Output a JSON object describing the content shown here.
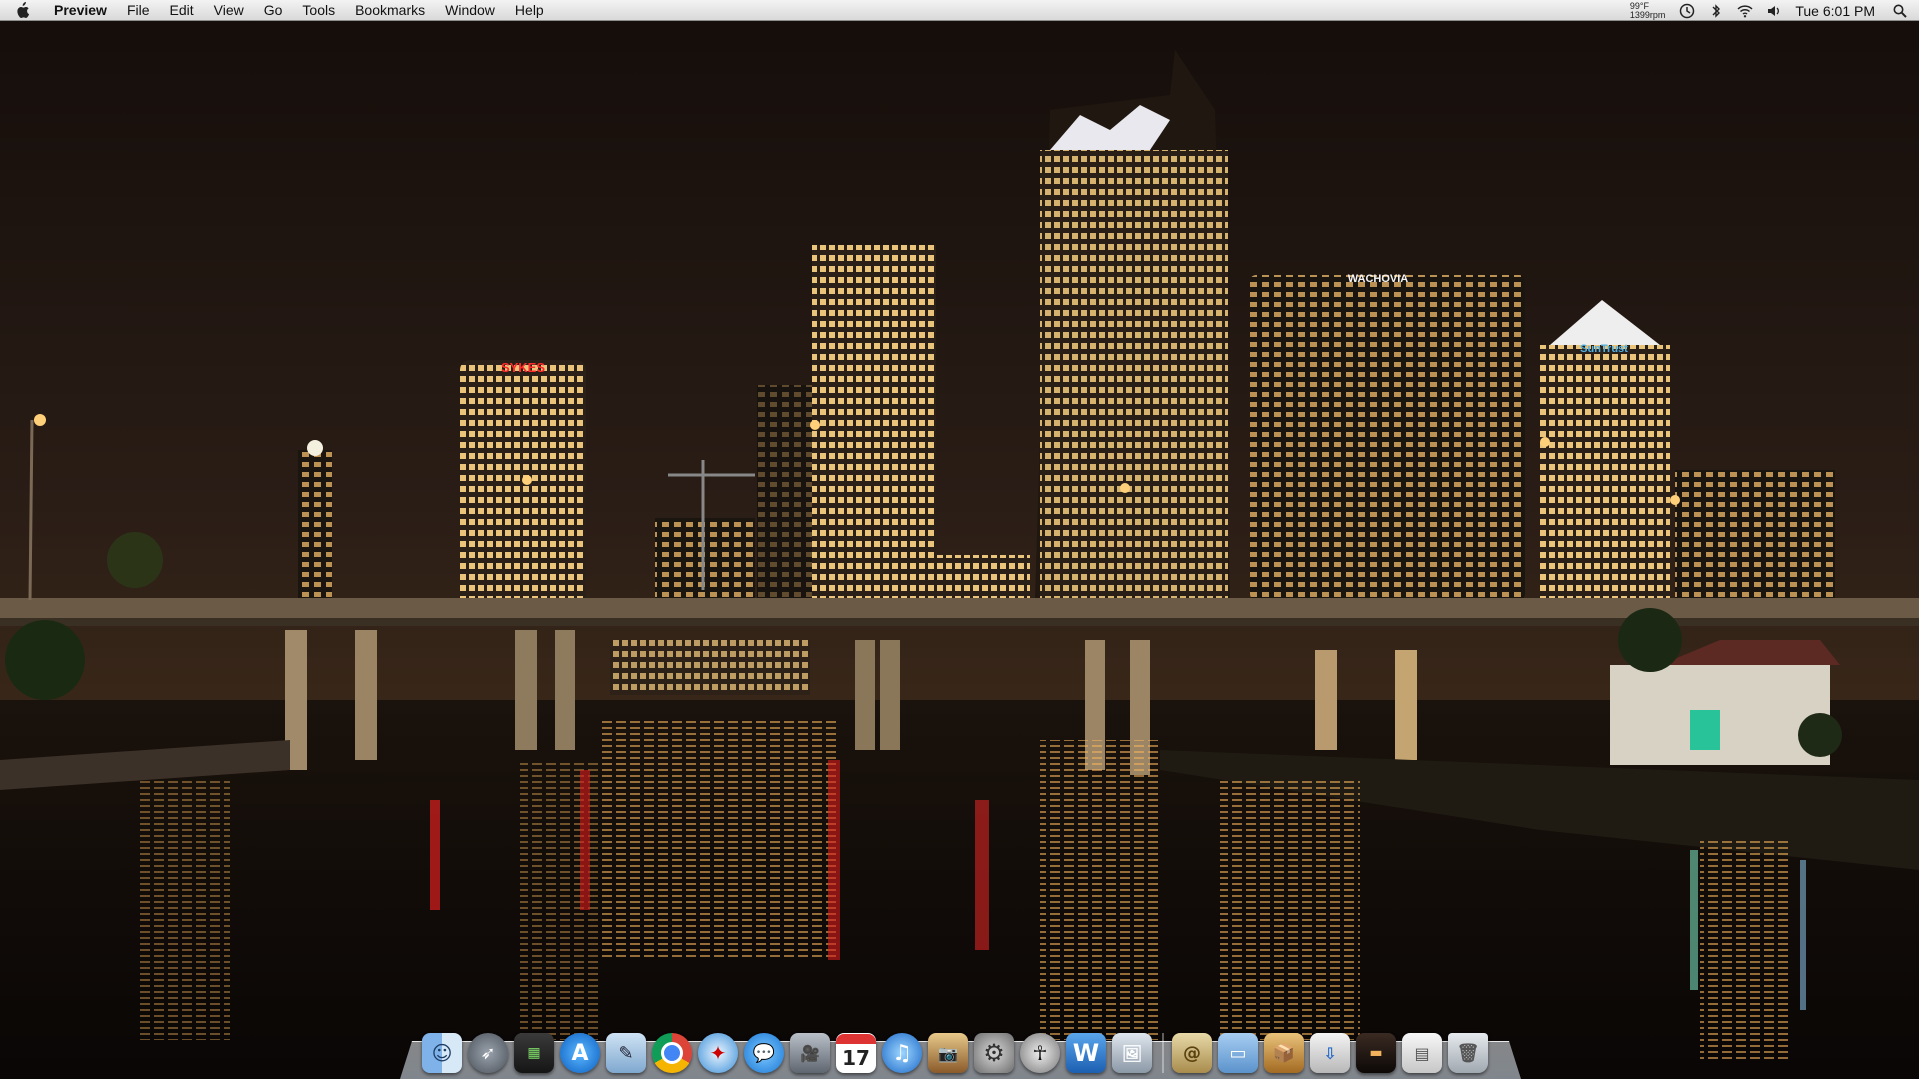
{
  "menubar": {
    "app_name": "Preview",
    "items": [
      "File",
      "Edit",
      "View",
      "Go",
      "Tools",
      "Bookmarks",
      "Window",
      "Help"
    ],
    "temperature": "99°F",
    "fan_speed": "1399rpm",
    "clock": "Tue 6:01 PM"
  },
  "wallpaper": {
    "signs": {
      "sykes": "SYKES",
      "wachovia": "WACHOVIA",
      "suntrust": "SunTrust"
    }
  },
  "dock": {
    "calendar_day": "17",
    "word_letter": "W",
    "apps": [
      "finder",
      "launchpad",
      "dashboard",
      "app-store",
      "preview",
      "chrome",
      "safari",
      "messages",
      "facetime",
      "calendar",
      "itunes",
      "iphoto",
      "system-preferences",
      "dictionary",
      "word",
      "preview-images",
      "contacts",
      "documents",
      "archive",
      "downloads",
      "stack",
      "window",
      "trash"
    ]
  },
  "colors": {
    "sky": "#1d1410",
    "water": "#0e0a08",
    "bridge": "#6b5a45",
    "menubar": "#e6e6e6"
  }
}
